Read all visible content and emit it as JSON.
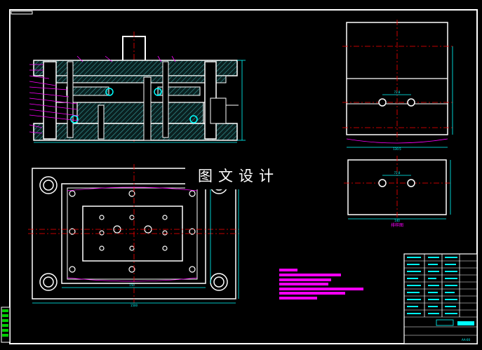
{
  "watermark": {
    "text": "图文设计"
  },
  "labels": {
    "top_right_dim_1": "72.8",
    "top_right_bottom_dim": "130.5",
    "bottom_right_dim_1": "72.8",
    "bottom_right_bottom_dim": "140",
    "bottom_right_caption": "排样图",
    "plan_dim_a": "150",
    "plan_dim_b": "1500",
    "title_block_code": "AA-00"
  },
  "colors": {
    "background": "#000000",
    "outline": "#ffffff",
    "centerline": "#ff0000",
    "dimension": "#00ffff",
    "accent": "#ff00ff",
    "hatch": "#2f8f8f",
    "sidebar": "#00cc00"
  }
}
